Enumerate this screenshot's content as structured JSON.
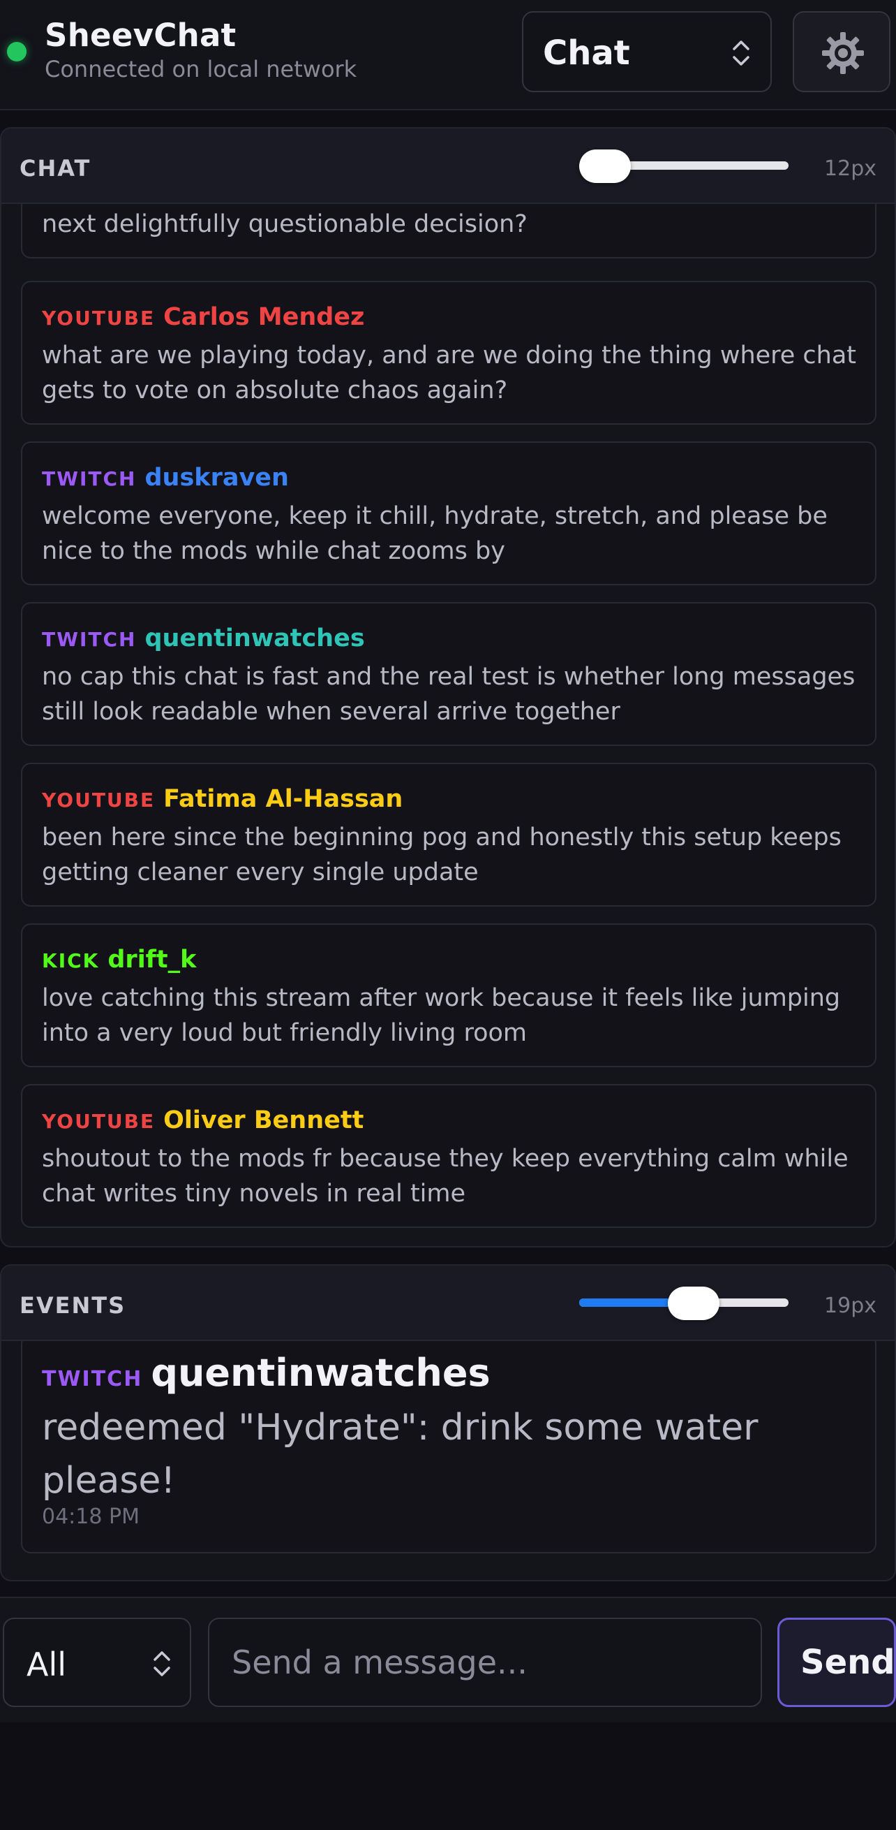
{
  "header": {
    "app_title": "SheevChat",
    "connection_status": "Connected on local network",
    "status_color": "#22c55e",
    "mode_select": {
      "selected": "Chat",
      "icon": "chevron-updown-icon"
    },
    "settings": {
      "icon": "gear-icon"
    }
  },
  "chat_panel": {
    "title": "CHAT",
    "font_size_label": "12px",
    "font_size_slider_value": 0.0,
    "partial_message_text": "next delightfully questionable decision?",
    "messages": [
      {
        "platform": "YOUTUBE",
        "platform_color": "#ef4444",
        "username": "Carlos Mendez",
        "username_color": "#ef4444",
        "text": "what are we playing today, and are we doing the thing where chat gets to vote on absolute chaos again?"
      },
      {
        "platform": "TWITCH",
        "platform_color": "#9b59f5",
        "username": "duskraven",
        "username_color": "#3b82f6",
        "text": "welcome everyone, keep it chill, hydrate, stretch, and please be nice to the mods while chat zooms by"
      },
      {
        "platform": "TWITCH",
        "platform_color": "#9b59f5",
        "username": "quentinwatches",
        "username_color": "#2ec4b6",
        "text": "no cap this chat is fast and the real test is whether long messages still look readable when several arrive together"
      },
      {
        "platform": "YOUTUBE",
        "platform_color": "#ef4444",
        "username": "Fatima Al-Hassan",
        "username_color": "#facc15",
        "text": "been here since the beginning pog and honestly this setup keeps getting cleaner every single update"
      },
      {
        "platform": "KICK",
        "platform_color": "#53fc18",
        "username": "drift_k",
        "username_color": "#53fc18",
        "text": "love catching this stream after work because it feels like jumping into a very loud but friendly living room"
      },
      {
        "platform": "YOUTUBE",
        "platform_color": "#ef4444",
        "username": "Oliver Bennett",
        "username_color": "#facc15",
        "text": "shoutout to the mods fr because they keep everything calm while chat writes tiny novels in real time"
      }
    ]
  },
  "events_panel": {
    "title": "EVENTS",
    "font_size_label": "19px",
    "font_size_slider_value": 0.56,
    "slider_accent": "#1e7bf2",
    "event": {
      "platform": "TWITCH",
      "platform_color": "#9b59f5",
      "username": "quentinwatches",
      "text": "redeemed \"Hydrate\": drink some water please!",
      "time": "04:18 PM"
    }
  },
  "composer": {
    "target_selected": "All",
    "placeholder": "Send a message...",
    "send_label": "Send",
    "send_accent": "#6b5bd6"
  }
}
